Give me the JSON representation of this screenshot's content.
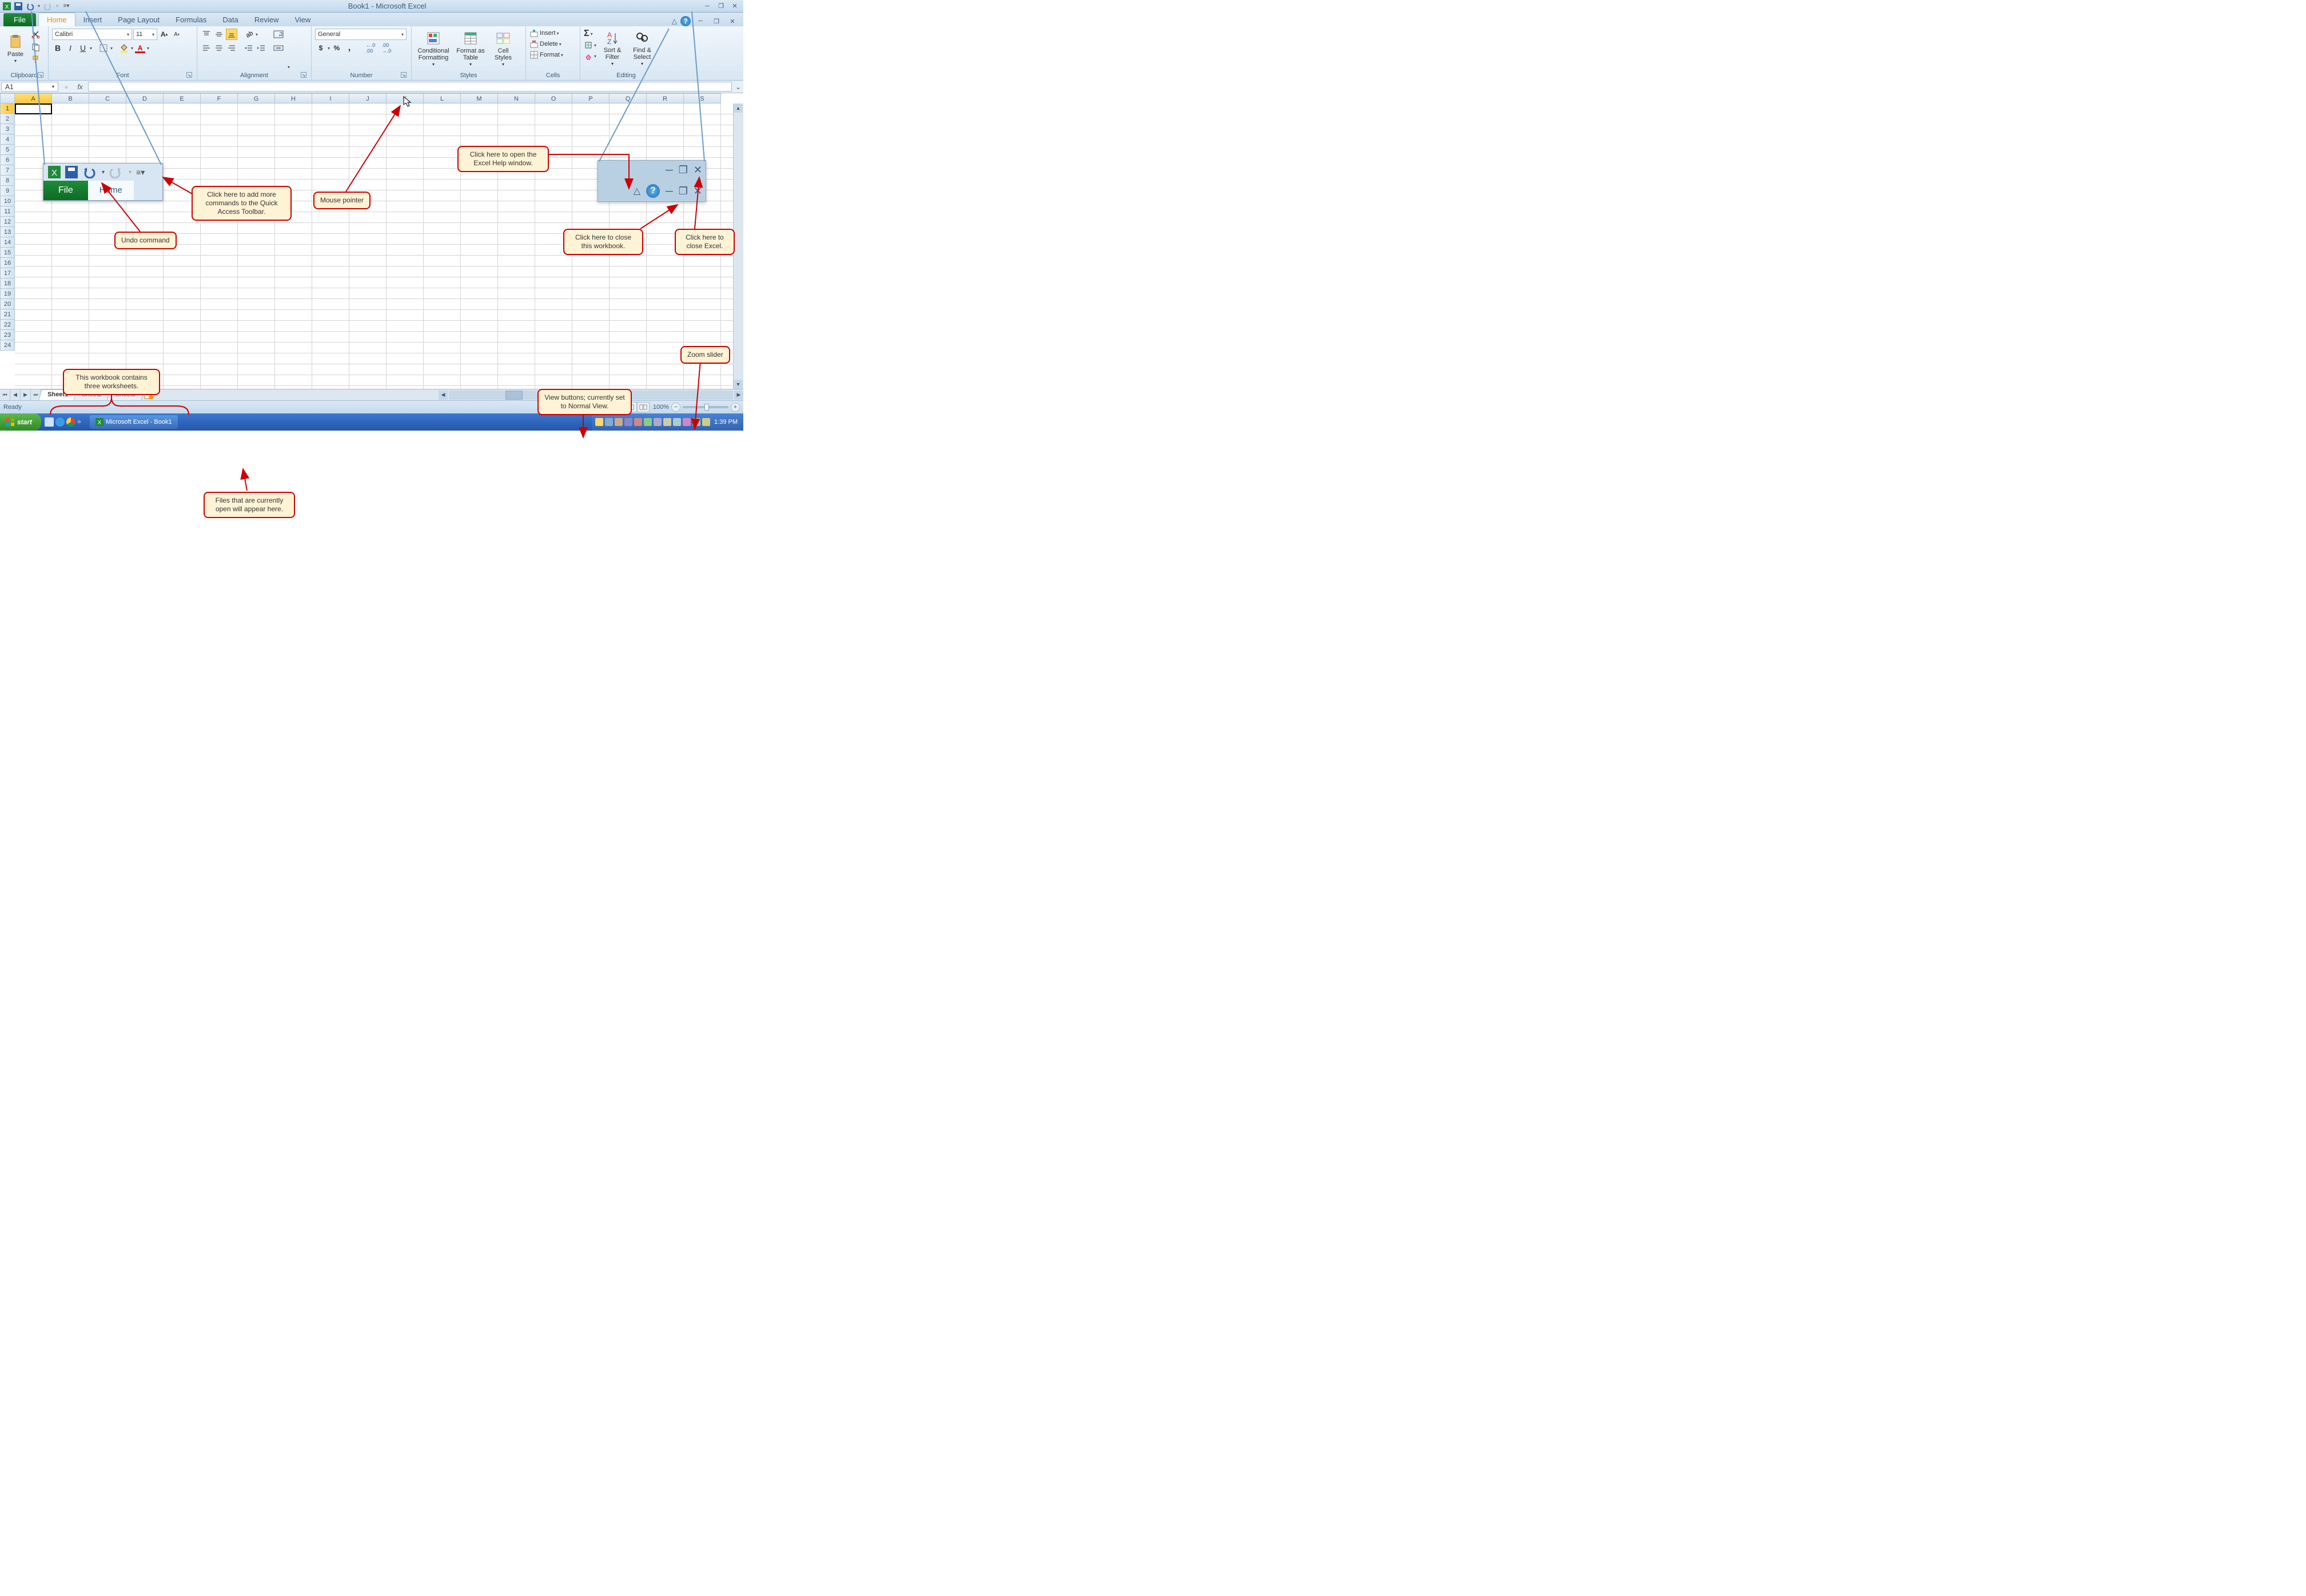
{
  "title": "Book1 - Microsoft Excel",
  "qat": {
    "save": "save-icon",
    "undo": "undo-icon",
    "redo": "redo-icon"
  },
  "tabs": {
    "file": "File",
    "items": [
      "Home",
      "Insert",
      "Page Layout",
      "Formulas",
      "Data",
      "Review",
      "View"
    ],
    "active": "Home"
  },
  "ribbon": {
    "clipboard": {
      "label": "Clipboard",
      "paste": "Paste"
    },
    "font": {
      "label": "Font",
      "name": "Calibri",
      "size": "11"
    },
    "alignment": {
      "label": "Alignment"
    },
    "number": {
      "label": "Number",
      "format": "General"
    },
    "styles": {
      "label": "Styles",
      "conditional": "Conditional Formatting",
      "formatas": "Format as Table",
      "cell": "Cell Styles"
    },
    "cells": {
      "label": "Cells",
      "insert": "Insert",
      "delete": "Delete",
      "format": "Format"
    },
    "editing": {
      "label": "Editing",
      "sort": "Sort & Filter",
      "find": "Find & Select"
    }
  },
  "formula": {
    "cellref": "A1",
    "fx": "fx"
  },
  "columns": [
    "A",
    "B",
    "C",
    "D",
    "E",
    "F",
    "G",
    "H",
    "I",
    "J",
    "K",
    "L",
    "M",
    "N",
    "O",
    "P",
    "Q",
    "R",
    "S"
  ],
  "rows": [
    "1",
    "2",
    "3",
    "4",
    "5",
    "6",
    "7",
    "8",
    "9",
    "10",
    "11",
    "12",
    "13",
    "14",
    "15",
    "16",
    "17",
    "18",
    "19",
    "20",
    "21",
    "22",
    "23",
    "24"
  ],
  "sheets": {
    "items": [
      "Sheet1",
      "Sheet2",
      "Sheet3"
    ],
    "active": "Sheet1"
  },
  "status": {
    "ready": "Ready",
    "zoom": "100%"
  },
  "taskbar": {
    "start": "start",
    "app": "Microsoft Excel - Book1",
    "time": "1:39 PM"
  },
  "callouts": {
    "qat_more": "Click here to add more commands to the Quick Access Toolbar.",
    "undo": "Undo command",
    "mouse": "Mouse pointer",
    "help": "Click here to open the Excel Help window.",
    "close_wb": "Click here to close this workbook.",
    "close_excel": "Click here to close Excel.",
    "zoom": "Zoom slider",
    "views": "View buttons; currently set to Normal View.",
    "sheets": "This workbook contains three worksheets.",
    "files_open": "Files that are currently open will appear here."
  },
  "inset_tabs": {
    "file": "File",
    "home": "Home"
  }
}
